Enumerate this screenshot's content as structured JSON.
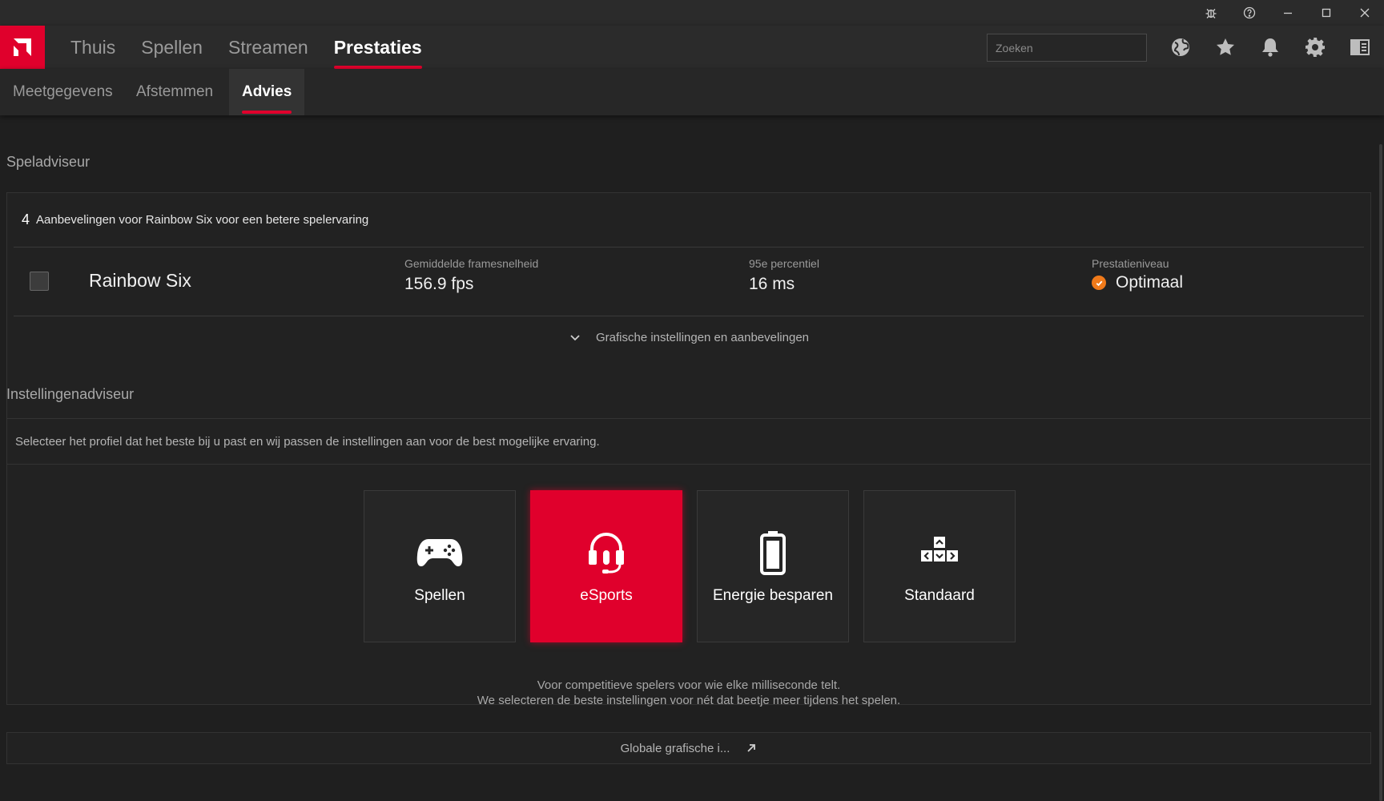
{
  "nav": {
    "tabs": [
      "Thuis",
      "Spellen",
      "Streamen",
      "Prestaties"
    ],
    "active_tab": "Prestaties",
    "search_placeholder": "Zoeken",
    "icons": [
      "globe-icon",
      "star-icon",
      "bell-icon",
      "gear-icon",
      "sidebar-icon"
    ]
  },
  "titlebar": {
    "icons": [
      "bug-icon",
      "help-icon",
      "minimize-icon",
      "maximize-icon",
      "close-icon"
    ]
  },
  "subnav": {
    "tabs": [
      "Meetgegevens",
      "Afstemmen",
      "Advies"
    ],
    "active_tab": "Advies"
  },
  "game_advisor": {
    "title": "Speladviseur",
    "rec_count": "4",
    "rec_text": "Aanbevelingen voor Rainbow Six voor een betere spelervaring",
    "game_name": "Rainbow Six",
    "avg_fps_label": "Gemiddelde framesnelheid",
    "avg_fps_value": "156.9 fps",
    "percentile_label": "95e percentiel",
    "percentile_value": "16 ms",
    "perf_label": "Prestatieniveau",
    "perf_value": "Optimaal",
    "expand_label": "Grafische instellingen en aanbevelingen"
  },
  "settings_advisor": {
    "title": "Instellingenadviseur",
    "description": "Selecteer het profiel dat het beste bij u past en wij passen de instellingen aan voor de best mogelijke ervaring.",
    "profiles": {
      "gaming": "Spellen",
      "esports": "eSports",
      "power_saving": "Energie besparen",
      "standard": "Standaard"
    },
    "selected_profile": "eSports",
    "info_line1": "Voor competitieve spelers voor wie elke milliseconde telt.",
    "info_line2": "We selecteren de beste instellingen voor nét dat beetje meer tijdens het spelen.",
    "global_link": "Globale grafische i..."
  },
  "colors": {
    "accent": "#e0002c",
    "optimal": "#f07a1a",
    "background": "#1f1f1f"
  }
}
